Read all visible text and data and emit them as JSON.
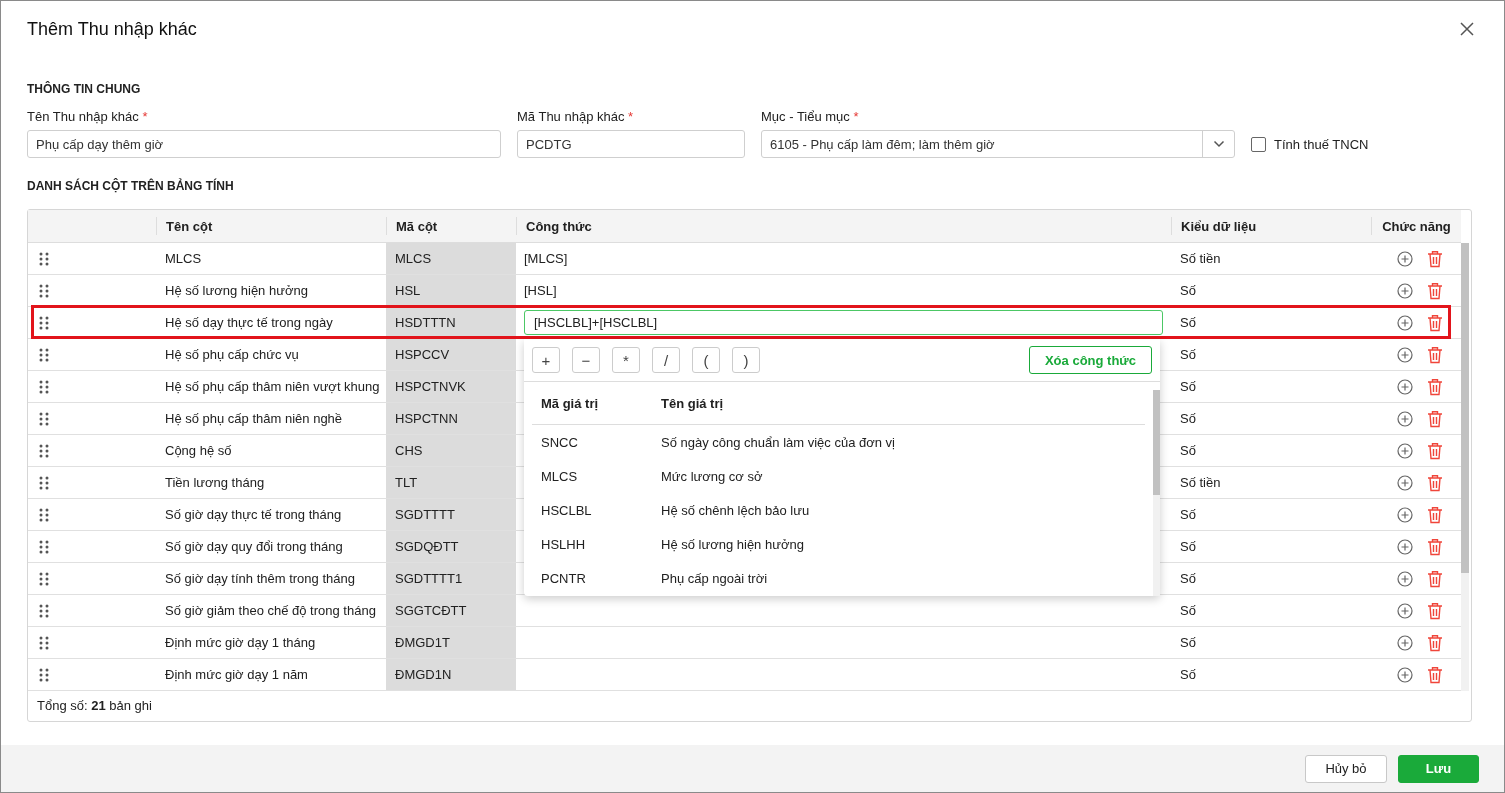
{
  "dialog": {
    "title": "Thêm Thu nhập khác"
  },
  "general": {
    "heading": "THÔNG TIN CHUNG",
    "name_field": {
      "label": "Tên Thu nhập khác",
      "required": true,
      "value": "Phụ cấp dạy thêm giờ"
    },
    "code_field": {
      "label": "Mã Thu nhập khác",
      "required": true,
      "value": "PCDTG"
    },
    "category_field": {
      "label": "Mục - Tiểu mục",
      "required": true,
      "value": "6105 - Phụ cấp làm đêm; làm thêm giờ"
    },
    "tax_checkbox": {
      "label": "Tính thuế TNCN",
      "checked": false
    }
  },
  "columns_section": {
    "heading": "DANH SÁCH CỘT TRÊN BẢNG TÍNH",
    "table": {
      "columns": [
        "Tên cột",
        "Mã cột",
        "Công thức",
        "Kiểu dữ liệu",
        "Chức năng"
      ],
      "rows": [
        {
          "name": "MLCS",
          "code": "MLCS",
          "formula": "[MLCS]",
          "type": "Số tiền",
          "editing": false,
          "highlighted": false
        },
        {
          "name": "Hệ số lương hiện hưởng",
          "code": "HSL",
          "formula": "[HSL]",
          "type": "Số",
          "editing": false,
          "highlighted": false
        },
        {
          "name": "Hệ số dạy thực tế trong ngày",
          "code": "HSDTTTN",
          "formula": "[HSCLBL]+[HSCLBL]",
          "type": "Số",
          "editing": true,
          "highlighted": true
        },
        {
          "name": "Hệ số phụ cấp chức vụ",
          "code": "HSPCCV",
          "type": "Số",
          "editing": false,
          "highlighted": false
        },
        {
          "name": "Hệ số phụ cấp thâm niên vượt khung",
          "code": "HSPCTNVK",
          "type": "Số",
          "editing": false,
          "highlighted": false
        },
        {
          "name": "Hệ số phụ cấp thâm niên nghề",
          "code": "HSPCTNN",
          "type": "Số",
          "editing": false,
          "highlighted": false
        },
        {
          "name": "Cộng hệ số",
          "code": "CHS",
          "type": "Số",
          "editing": false,
          "highlighted": false
        },
        {
          "name": "Tiền lương tháng",
          "code": "TLT",
          "type": "Số tiền",
          "editing": false,
          "highlighted": false
        },
        {
          "name": "Số giờ dạy thực tế trong tháng",
          "code": "SGDTTTT",
          "type": "Số",
          "editing": false,
          "highlighted": false
        },
        {
          "name": "Số giờ dạy quy đổi trong tháng",
          "code": "SGDQĐTT",
          "type": "Số",
          "editing": false,
          "highlighted": false
        },
        {
          "name": "Số giờ dạy tính thêm trong tháng",
          "code": "SGDTTTT1",
          "type": "Số",
          "editing": false,
          "highlighted": false
        },
        {
          "name": "Số giờ giảm theo chế độ trong tháng",
          "code": "SGGTCĐTT",
          "type": "Số",
          "editing": false,
          "highlighted": false
        },
        {
          "name": "Định mức giờ dạy 1 tháng",
          "code": "ĐMGD1T",
          "type": "Số",
          "editing": false,
          "highlighted": false
        },
        {
          "name": "Định mức giờ dạy 1 năm",
          "code": "ĐMGD1N",
          "type": "Số",
          "editing": false,
          "highlighted": false
        }
      ],
      "total": {
        "label": "Tổng số: **21** bản ghi"
      }
    }
  },
  "formula_popup": {
    "operators": [
      "+",
      "−",
      "*",
      "/",
      "(",
      ")"
    ],
    "clear_button": "Xóa công thức",
    "columns": [
      "Mã giá trị",
      "Tên giá trị"
    ],
    "items": [
      {
        "code": "SNCC",
        "name": "Số ngày công chuẩn làm việc của đơn vị"
      },
      {
        "code": "MLCS",
        "name": "Mức lương cơ sở"
      },
      {
        "code": "HSCLBL",
        "name": "Hệ số chênh lệch bảo lưu"
      },
      {
        "code": "HSLHH",
        "name": "Hệ số lương hiện hưởng"
      },
      {
        "code": "PCNTR",
        "name": "Phụ cấp ngoài trời"
      }
    ]
  },
  "footer": {
    "buttons": [
      {
        "label": "Hủy bỏ",
        "kind": "secondary"
      },
      {
        "label": "Lưu",
        "kind": "primary"
      }
    ]
  }
}
